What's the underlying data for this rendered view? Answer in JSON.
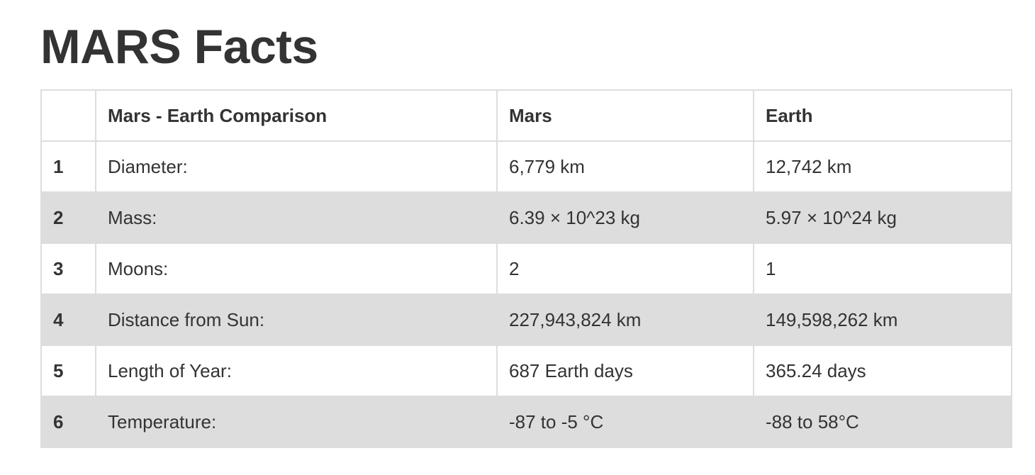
{
  "page": {
    "title": "MARS Facts"
  },
  "table": {
    "headers": [
      "",
      "Mars - Earth Comparison",
      "Mars",
      "Earth"
    ],
    "rows": [
      {
        "index": "1",
        "label": "Diameter:",
        "mars": "6,779 km",
        "earth": "12,742 km"
      },
      {
        "index": "2",
        "label": "Mass:",
        "mars": "6.39 × 10^23 kg",
        "earth": "5.97 × 10^24 kg"
      },
      {
        "index": "3",
        "label": "Moons:",
        "mars": "2",
        "earth": "1"
      },
      {
        "index": "4",
        "label": "Distance from Sun:",
        "mars": "227,943,824 km",
        "earth": "149,598,262 km"
      },
      {
        "index": "5",
        "label": "Length of Year:",
        "mars": "687 Earth days",
        "earth": "365.24 days"
      },
      {
        "index": "6",
        "label": "Temperature:",
        "mars": "-87 to -5 °C",
        "earth": "-88 to 58°C"
      }
    ]
  },
  "colors": {
    "text": "#333333",
    "border": "#dddddd",
    "stripe": "#dddddd",
    "background": "#ffffff"
  }
}
